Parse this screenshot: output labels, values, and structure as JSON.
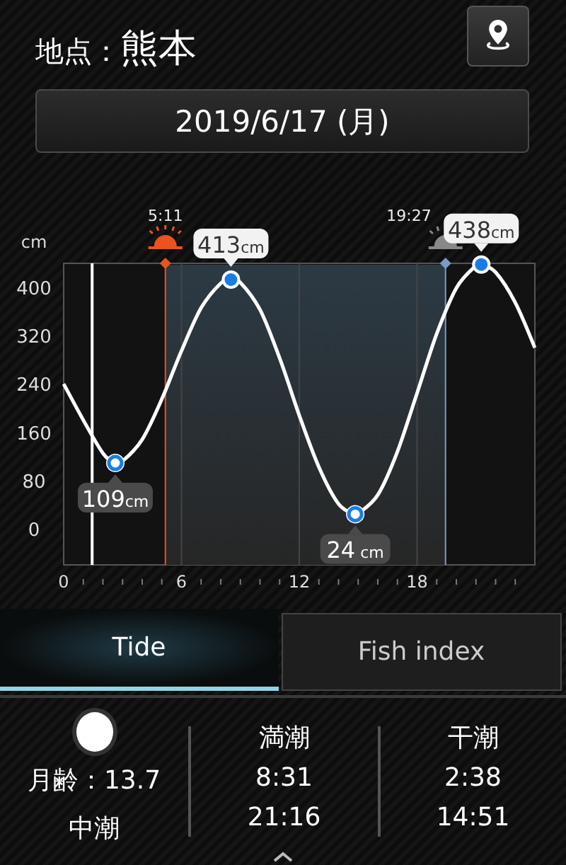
{
  "header": {
    "label": "地点：",
    "location": "熊本"
  },
  "date": "2019/6/17 (月)",
  "chart": {
    "chart_data": {
      "type": "line",
      "ylabel": "cm",
      "x": [
        0,
        1,
        2,
        2.63,
        3,
        4,
        5,
        6,
        7,
        8,
        8.52,
        9,
        10,
        11,
        12,
        13,
        14,
        14.85,
        15,
        16,
        17,
        18,
        19,
        20,
        21,
        21.27,
        22,
        23,
        24
      ],
      "series": [
        {
          "color": "#ffffff",
          "values": [
            240,
            180,
            125,
            109,
            112,
            148,
            215,
            295,
            366,
            407,
            413,
            408,
            363,
            283,
            188,
            102,
            41,
            24,
            25,
            56,
            128,
            225,
            323,
            399,
            436,
            438,
            425,
            375,
            300
          ]
        }
      ],
      "xlim": [
        0,
        24
      ],
      "ylim": [
        -60,
        440
      ],
      "xticks": [
        0,
        6,
        12,
        18
      ],
      "yticks": [
        0,
        80,
        160,
        240,
        320,
        400
      ],
      "grid": true,
      "ref_lines": [
        {
          "axis": "x",
          "value": 1.45,
          "color": "#ffffff"
        },
        {
          "axis": "x",
          "value": 5.18,
          "color": "#e8531f",
          "label": "5:11"
        },
        {
          "axis": "x",
          "value": 19.45,
          "color": "#7a9cc4",
          "label": "19:27"
        }
      ],
      "bands": [
        {
          "axis": "x",
          "from": 5.18,
          "to": 19.45,
          "color": "#2c3a44"
        }
      ]
    },
    "extremes": [
      {
        "label": "109",
        "unit": "cm"
      },
      {
        "label": "413",
        "unit": "cm"
      },
      {
        "label": "24",
        "unit": " cm"
      },
      {
        "label": "438",
        "unit": "cm"
      }
    ]
  },
  "tabs": [
    {
      "label": "Tide",
      "selected": true
    },
    {
      "label": "Fish index",
      "selected": false
    }
  ],
  "moon": {
    "age": "月齢：13.7",
    "tide_name": "中潮"
  },
  "tide_times": [
    {
      "title": "満潮",
      "times": [
        "8:31",
        "21:16"
      ]
    },
    {
      "title": "干潮",
      "times": [
        "2:38",
        "14:51"
      ]
    }
  ]
}
